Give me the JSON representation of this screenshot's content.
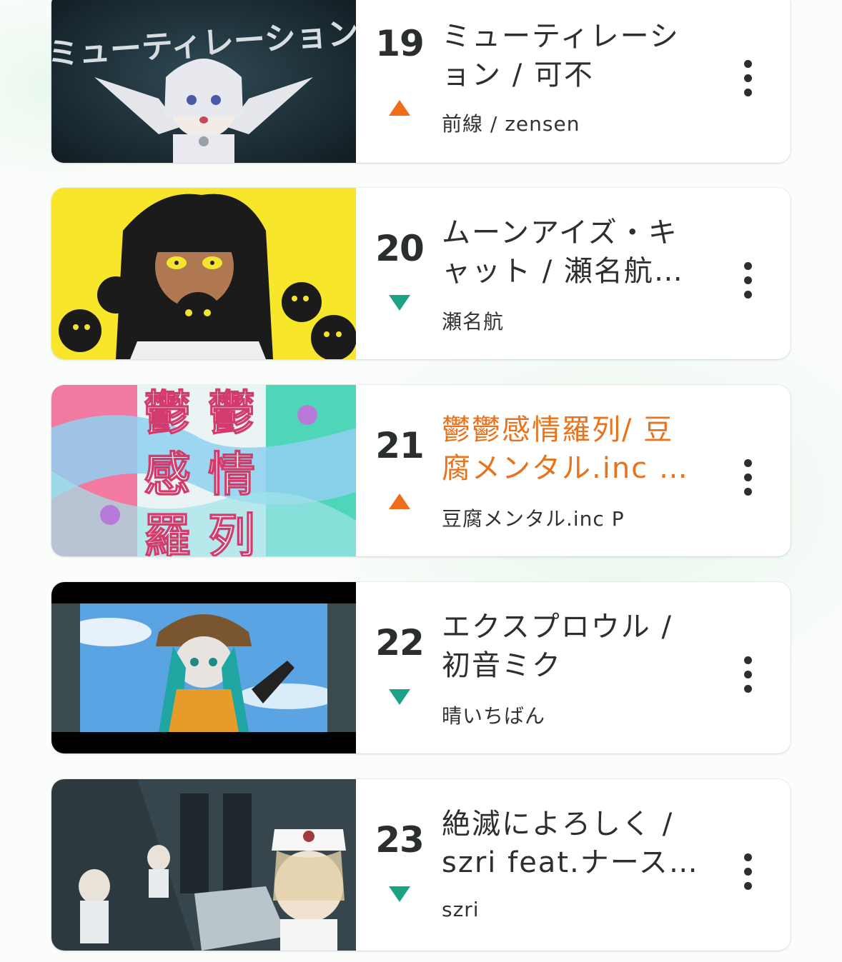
{
  "colors": {
    "rank_up": "#ef6c1b",
    "rank_down": "#1aa384",
    "highlight_title": "#e8731c",
    "text": "#2b2f2e"
  },
  "items": [
    {
      "rank": "19",
      "trend": "up",
      "trend_icon": "triangle-up-icon",
      "title": "ミューティレーション / 可不",
      "artist": "前線 / zensen",
      "thumbnail_text": "ミューティレーション",
      "highlighted": false
    },
    {
      "rank": "20",
      "trend": "down",
      "trend_icon": "triangle-down-icon",
      "title": "ムーンアイズ・キャット / 瀬名航…",
      "artist": "瀬名航",
      "highlighted": false
    },
    {
      "rank": "21",
      "trend": "up",
      "trend_icon": "triangle-up-icon",
      "title": "鬱鬱感情羅列/ 豆腐メンタル.inc …",
      "artist": "豆腐メンタル.inc P",
      "thumbnail_text": [
        "鬱",
        "鬱",
        "感",
        "情",
        "羅",
        "列"
      ],
      "highlighted": true
    },
    {
      "rank": "22",
      "trend": "down",
      "trend_icon": "triangle-down-icon",
      "title": "エクスプロウル / 初音ミク",
      "artist": "晴いちばん",
      "highlighted": false
    },
    {
      "rank": "23",
      "trend": "down",
      "trend_icon": "triangle-down-icon",
      "title": "絶滅によろしく / szri feat.ナース…",
      "artist": "szri",
      "highlighted": false
    }
  ]
}
